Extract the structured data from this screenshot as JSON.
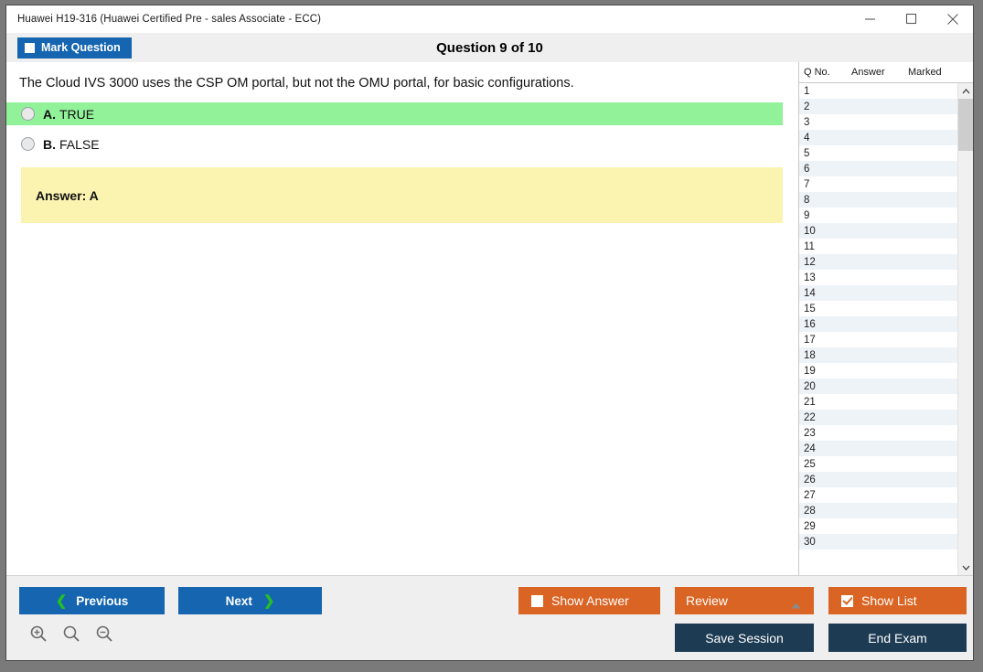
{
  "window": {
    "title": "Huawei H19-316 (Huawei Certified Pre - sales Associate - ECC)",
    "controls": {
      "minimize": "minimize-icon",
      "maximize": "maximize-icon",
      "close": "close-icon"
    }
  },
  "header": {
    "mark_question_label": "Mark Question",
    "mark_question_checked": false,
    "question_title": "Question 9 of 10"
  },
  "question": {
    "text": "The Cloud IVS 3000 uses the CSP OM portal, but not the OMU portal, for basic configurations.",
    "options": [
      {
        "letter": "A.",
        "text": "TRUE",
        "correct": true,
        "selected": false
      },
      {
        "letter": "B.",
        "text": "FALSE",
        "correct": false,
        "selected": false
      }
    ],
    "answer_label": "Answer: A"
  },
  "list_panel": {
    "columns": [
      "Q No.",
      "Answer",
      "Marked"
    ],
    "rows": [
      {
        "no": "1",
        "answer": "",
        "marked": ""
      },
      {
        "no": "2",
        "answer": "",
        "marked": ""
      },
      {
        "no": "3",
        "answer": "",
        "marked": ""
      },
      {
        "no": "4",
        "answer": "",
        "marked": ""
      },
      {
        "no": "5",
        "answer": "",
        "marked": ""
      },
      {
        "no": "6",
        "answer": "",
        "marked": ""
      },
      {
        "no": "7",
        "answer": "",
        "marked": ""
      },
      {
        "no": "8",
        "answer": "",
        "marked": ""
      },
      {
        "no": "9",
        "answer": "",
        "marked": ""
      },
      {
        "no": "10",
        "answer": "",
        "marked": ""
      },
      {
        "no": "11",
        "answer": "",
        "marked": ""
      },
      {
        "no": "12",
        "answer": "",
        "marked": ""
      },
      {
        "no": "13",
        "answer": "",
        "marked": ""
      },
      {
        "no": "14",
        "answer": "",
        "marked": ""
      },
      {
        "no": "15",
        "answer": "",
        "marked": ""
      },
      {
        "no": "16",
        "answer": "",
        "marked": ""
      },
      {
        "no": "17",
        "answer": "",
        "marked": ""
      },
      {
        "no": "18",
        "answer": "",
        "marked": ""
      },
      {
        "no": "19",
        "answer": "",
        "marked": ""
      },
      {
        "no": "20",
        "answer": "",
        "marked": ""
      },
      {
        "no": "21",
        "answer": "",
        "marked": ""
      },
      {
        "no": "22",
        "answer": "",
        "marked": ""
      },
      {
        "no": "23",
        "answer": "",
        "marked": ""
      },
      {
        "no": "24",
        "answer": "",
        "marked": ""
      },
      {
        "no": "25",
        "answer": "",
        "marked": ""
      },
      {
        "no": "26",
        "answer": "",
        "marked": ""
      },
      {
        "no": "27",
        "answer": "",
        "marked": ""
      },
      {
        "no": "28",
        "answer": "",
        "marked": ""
      },
      {
        "no": "29",
        "answer": "",
        "marked": ""
      },
      {
        "no": "30",
        "answer": "",
        "marked": ""
      }
    ]
  },
  "footer": {
    "previous_label": "Previous",
    "next_label": "Next",
    "show_answer_label": "Show Answer",
    "show_answer_checked": false,
    "review_label": "Review",
    "show_list_label": "Show List",
    "show_list_checked": true,
    "save_session_label": "Save Session",
    "end_exam_label": "End Exam",
    "zoom_icons": [
      "zoom-in-icon",
      "zoom-reset-icon",
      "zoom-out-icon"
    ]
  },
  "colors": {
    "accent_blue": "#1565b0",
    "accent_orange": "#da6423",
    "navy": "#1d3b53",
    "correct_green": "#92f29a",
    "answer_yellow": "#faf4b0"
  }
}
